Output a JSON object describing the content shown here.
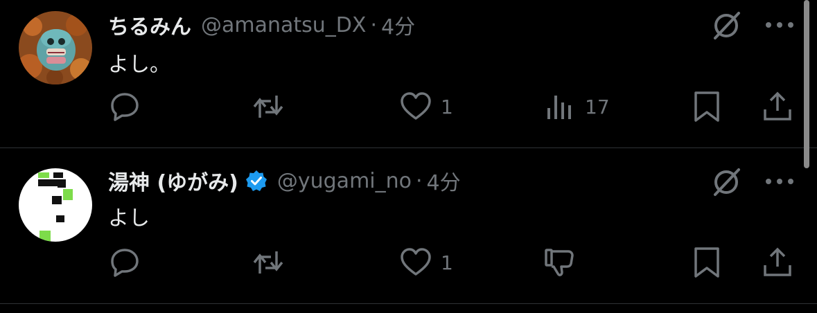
{
  "tweets": [
    {
      "display_name": "ちるみん",
      "handle": "@amanatsu_DX",
      "separator": "·",
      "time": "4分",
      "verified": false,
      "text": "よし。",
      "actions": {
        "reply_count": "",
        "repost_count": "",
        "like_count": "1",
        "views_count": "17"
      },
      "icons": [
        "grok-icon",
        "more-icon",
        "reply-icon",
        "repost-icon",
        "heart-icon",
        "views-icon",
        "bookmark-icon",
        "share-icon"
      ]
    },
    {
      "display_name": "湯神 (ゆがみ)",
      "handle": "@yugami_no",
      "separator": "·",
      "time": "4分",
      "verified": true,
      "text": "よし",
      "actions": {
        "reply_count": "",
        "repost_count": "",
        "like_count": "1"
      },
      "icons": [
        "grok-icon",
        "more-icon",
        "reply-icon",
        "repost-icon",
        "heart-icon",
        "dislike-icon",
        "bookmark-icon",
        "share-icon"
      ]
    }
  ],
  "colors": {
    "background": "#000000",
    "text_primary": "#e7e9ea",
    "text_secondary": "#71767b",
    "divider": "#2f3336",
    "verified_badge": "#1d9bf0"
  }
}
